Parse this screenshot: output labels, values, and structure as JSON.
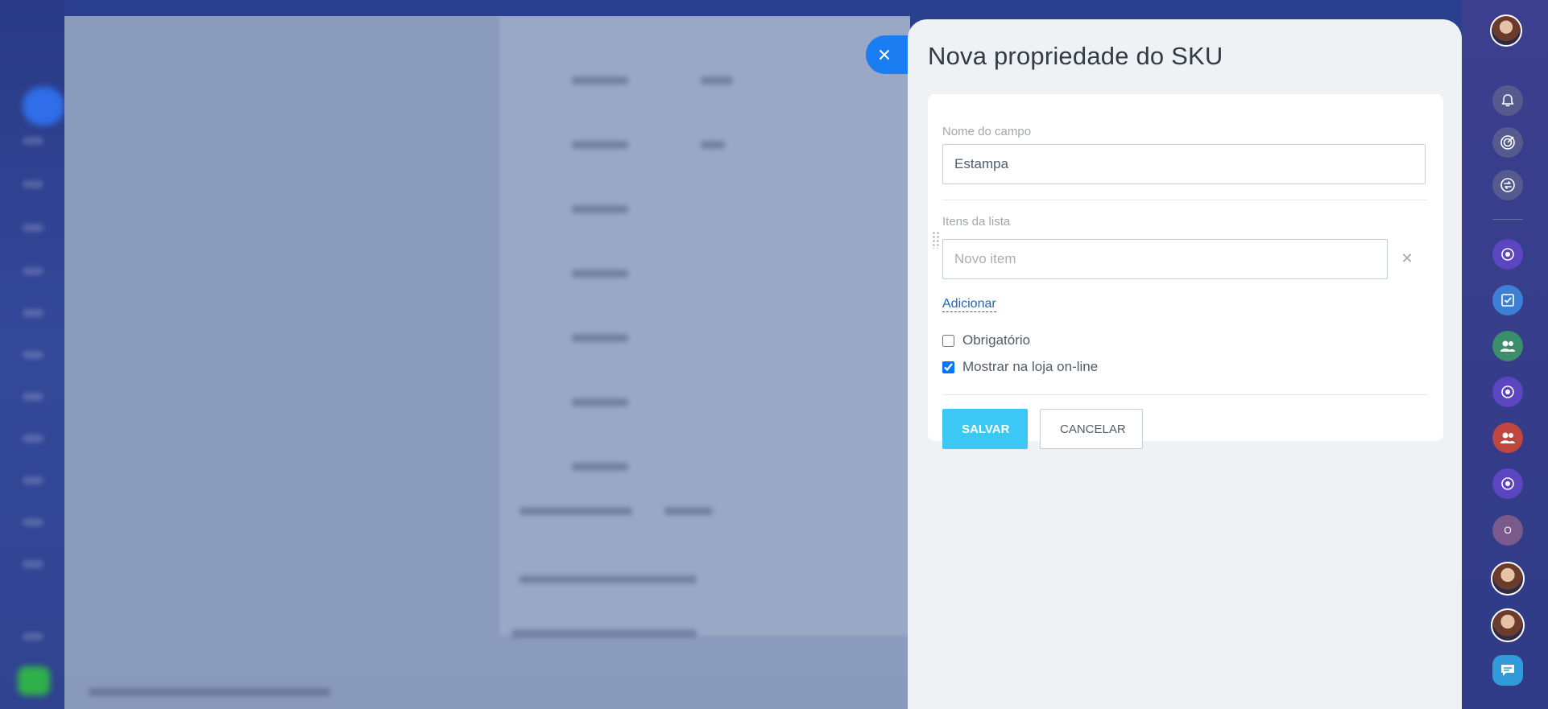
{
  "panel": {
    "title": "Nova propriedade do SKU",
    "field_name": {
      "label": "Nome do campo",
      "value": "Estampa"
    },
    "list_items": {
      "label": "Itens da lista",
      "new_item_placeholder": "Novo item",
      "remove_glyph": "✕",
      "add_link": "Adicionar"
    },
    "options": {
      "required": {
        "label": "Obrigatório",
        "checked": false
      },
      "show_online": {
        "label": "Mostrar na loja on-line",
        "checked": true
      }
    },
    "buttons": {
      "save": "SALVAR",
      "cancel": "CANCELAR"
    }
  },
  "right_sidebar": {
    "icons": [
      "user-avatar",
      "bell-icon",
      "target-icon",
      "sync-icon",
      "openline-icon",
      "tasks-icon",
      "group-icon",
      "openline-icon",
      "group-icon",
      "openline-icon",
      "circle-icon",
      "user-avatar",
      "user-avatar",
      "chat-icon"
    ],
    "small_badge_text": "O"
  },
  "colors": {
    "accent_blue": "#1a7df2",
    "save_button": "#3bc8f5",
    "link": "#2067b0",
    "panel_bg": "#eef2f4"
  }
}
